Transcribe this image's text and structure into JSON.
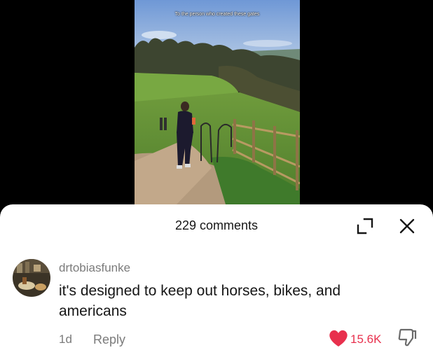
{
  "video": {
    "caption": "To the person who created these gates"
  },
  "comments_sheet": {
    "title": "229 comments"
  },
  "comment": {
    "username": "drtobiasfunke",
    "text": "it's designed to keep out horses, bikes, and americans",
    "time": "1d",
    "reply_label": "Reply",
    "like_count": "15.6K"
  },
  "colors": {
    "like": "#e8304d",
    "secondary_text": "#7b7b7b",
    "primary_text": "#161616"
  },
  "icons": {
    "expand": "expand-icon",
    "close": "close-icon",
    "like": "heart-icon",
    "dislike": "thumbs-down-icon"
  }
}
